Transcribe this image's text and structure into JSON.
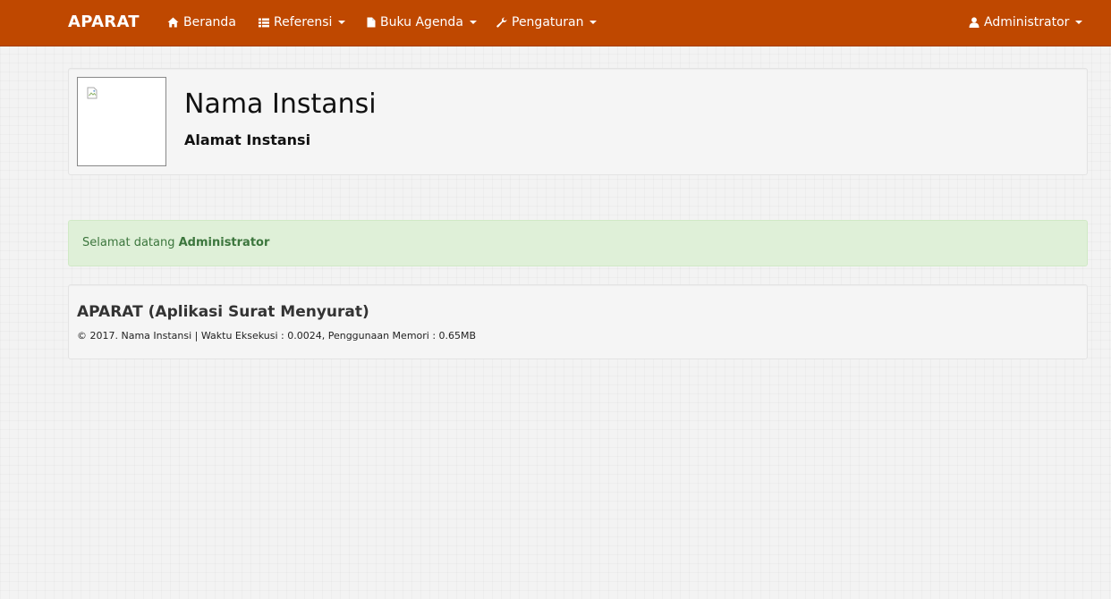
{
  "navbar": {
    "brand": "APARAT",
    "items": [
      {
        "label": "Beranda",
        "icon": "home-icon"
      },
      {
        "label": "Referensi",
        "icon": "list-icon"
      },
      {
        "label": "Buku Agenda",
        "icon": "file-icon"
      },
      {
        "label": "Pengaturan",
        "icon": "wrench-icon"
      }
    ],
    "user": {
      "label": "Administrator",
      "icon": "user-icon"
    },
    "background_color": "#bf4800"
  },
  "header": {
    "org_name": "Nama Instansi",
    "org_address": "Alamat Instansi",
    "logo_icon": "broken-image-icon"
  },
  "alert": {
    "prefix": "Selamat datang",
    "user": "Administrator",
    "color": "#3c763d",
    "background": "#dff0d8"
  },
  "footer": {
    "app_title": "APARAT (Aplikasi Surat Menyurat)",
    "info": "© 2017. Nama Instansi | Waktu Eksekusi : 0.0024, Penggunaan Memori : 0.65MB"
  }
}
